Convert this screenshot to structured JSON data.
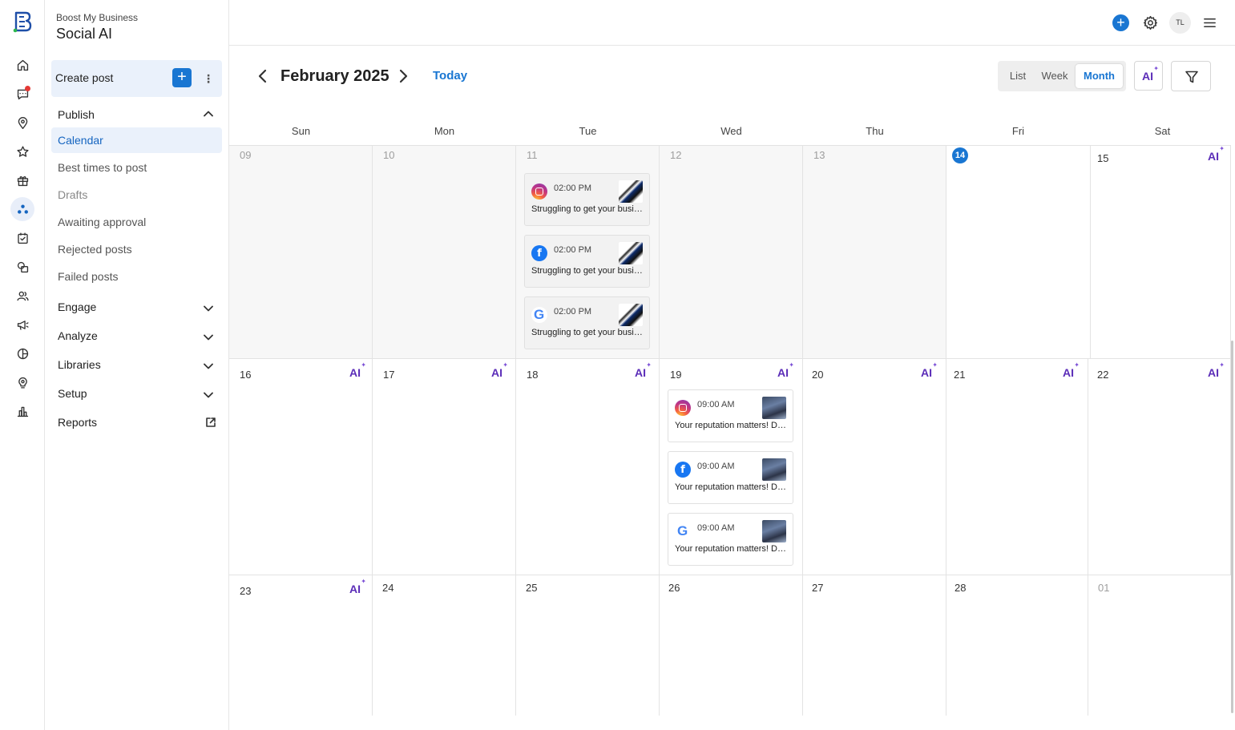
{
  "app": {
    "org": "Boost My Business",
    "product": "Social AI"
  },
  "sidebar": {
    "create_post": "Create post",
    "create_plus": "+",
    "more": "⋮",
    "publish": {
      "label": "Publish",
      "items": [
        "Calendar",
        "Best times to post",
        "Drafts",
        "Awaiting approval",
        "Rejected posts",
        "Failed posts"
      ]
    },
    "sections": [
      "Engage",
      "Analyze",
      "Libraries",
      "Setup"
    ],
    "reports": "Reports"
  },
  "rail_icons": [
    "home-icon",
    "chat-icon",
    "location-icon",
    "star-icon",
    "gift-icon",
    "social-icon",
    "task-icon",
    "pages-icon",
    "people-icon",
    "megaphone-icon",
    "chart-pie-icon",
    "bulb-icon",
    "bar-chart-icon"
  ],
  "topbar": {
    "plus": "+",
    "avatar_initials": "TL"
  },
  "calendar": {
    "title": "February 2025",
    "today_label": "Today",
    "views": [
      "List",
      "Week",
      "Month"
    ],
    "selected_view": "Month",
    "ai_label": "AI",
    "weekdays": [
      "Sun",
      "Mon",
      "Tue",
      "Wed",
      "Thu",
      "Fri",
      "Sat"
    ],
    "weeks": [
      [
        "09",
        "10",
        "11",
        "12",
        "13",
        "14",
        "15"
      ],
      [
        "16",
        "17",
        "18",
        "19",
        "20",
        "21",
        "22"
      ],
      [
        "23",
        "24",
        "25",
        "26",
        "27",
        "28",
        "01"
      ]
    ],
    "today_day": "14",
    "posts_tue_11": [
      {
        "network": "instagram",
        "time": "02:00 PM",
        "text": "Struggling to get your business noticed?"
      },
      {
        "network": "facebook",
        "time": "02:00 PM",
        "text": "Struggling to get your business noticed?"
      },
      {
        "network": "google",
        "time": "02:00 PM",
        "text": "Struggling to get your business noticed?"
      }
    ],
    "posts_wed_19": [
      {
        "network": "instagram",
        "time": "09:00 AM",
        "text": "Your reputation matters! Don't let it slip"
      },
      {
        "network": "facebook",
        "time": "09:00 AM",
        "text": "Your reputation matters! Don't let it slip"
      },
      {
        "network": "google",
        "time": "09:00 AM",
        "text": "Your reputation matters! Don't let it slip"
      }
    ]
  },
  "colors": {
    "accent": "#1976d2",
    "ai_purple": "#5b2db8",
    "active_bg": "#eaf1fb"
  }
}
